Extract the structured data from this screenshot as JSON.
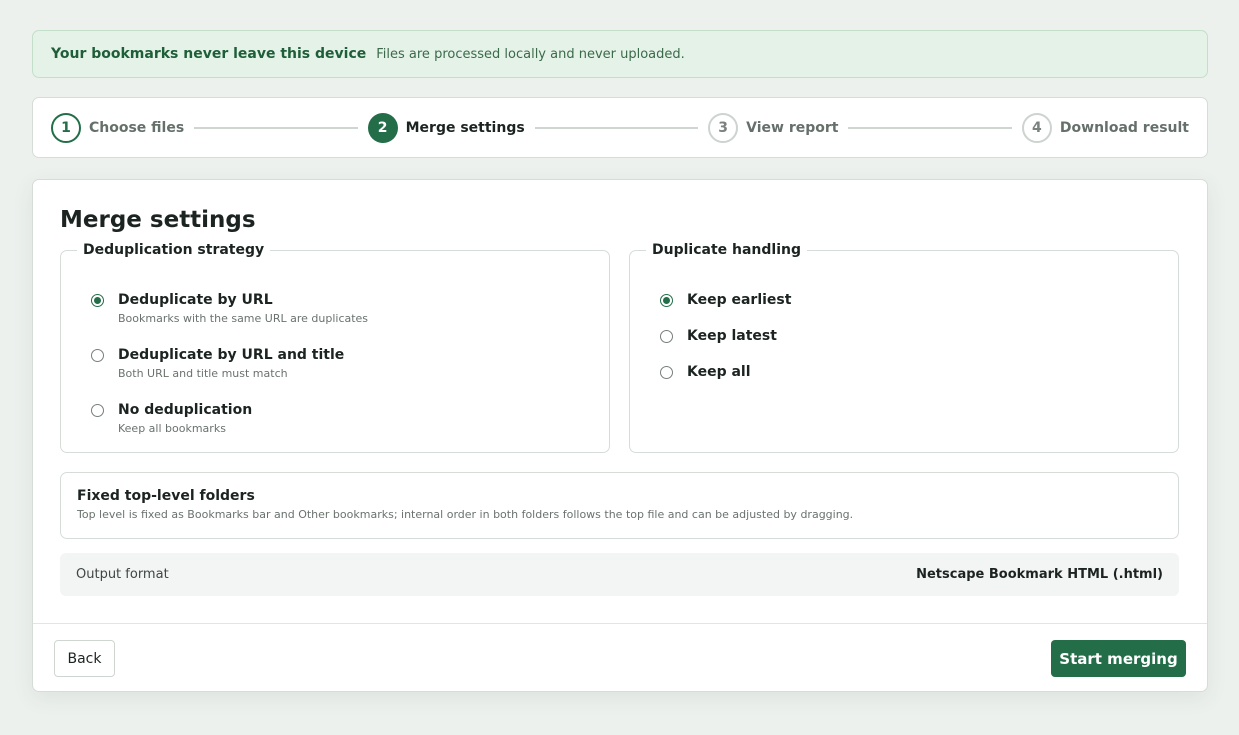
{
  "banner": {
    "title": "Your bookmarks never leave this device",
    "text": "Files are processed locally and never uploaded."
  },
  "steps": [
    {
      "number": "1",
      "label": "Choose files",
      "state": "done"
    },
    {
      "number": "2",
      "label": "Merge settings",
      "state": "active"
    },
    {
      "number": "3",
      "label": "View report",
      "state": "todo"
    },
    {
      "number": "4",
      "label": "Download result",
      "state": "todo"
    }
  ],
  "main": {
    "title": "Merge settings",
    "dedup": {
      "legend": "Deduplication strategy",
      "options": [
        {
          "label": "Deduplicate by URL",
          "desc": "Bookmarks with the same URL are duplicates",
          "checked": true
        },
        {
          "label": "Deduplicate by URL and title",
          "desc": "Both URL and title must match",
          "checked": false
        },
        {
          "label": "No deduplication",
          "desc": "Keep all bookmarks",
          "checked": false
        }
      ]
    },
    "handling": {
      "legend": "Duplicate handling",
      "options": [
        {
          "label": "Keep earliest",
          "checked": true
        },
        {
          "label": "Keep latest",
          "checked": false
        },
        {
          "label": "Keep all",
          "checked": false
        }
      ]
    },
    "fixed": {
      "title": "Fixed top-level folders",
      "desc": "Top level is fixed as Bookmarks bar and Other bookmarks; internal order in both folders follows the top file and can be adjusted by dragging."
    },
    "format": {
      "label": "Output format",
      "value": "Netscape Bookmark HTML (.html)"
    }
  },
  "footer": {
    "back_label": "Back",
    "start_label": "Start merging"
  },
  "colors": {
    "accent": "#236e48",
    "banner_bg": "#e5f2e8",
    "page_bg": "#edf1ee"
  }
}
